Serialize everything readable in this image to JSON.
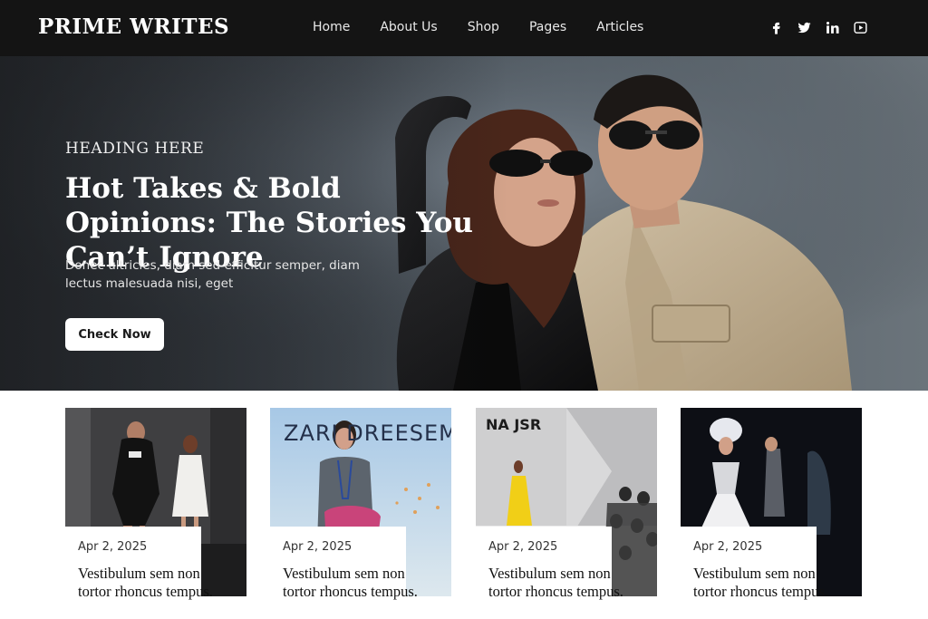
{
  "brand": "PRIME WRITES",
  "nav": [
    "Home",
    "About Us",
    "Shop",
    "Pages",
    "Articles"
  ],
  "social": [
    "facebook-icon",
    "twitter-icon",
    "linkedin-icon",
    "youtube-icon"
  ],
  "hero": {
    "eyebrow": "HEADING HERE",
    "headline": "Hot Takes & Bold Opinions: The Stories You Can’t Ignore",
    "lede": "Donec ultricles, diam sed efficitur semper, diam lectus malesuada nisi, eget",
    "cta": "Check Now"
  },
  "cards": [
    {
      "date": "Apr 2, 2025",
      "title": "Vestibulum sem non tortor rhoncus tempus."
    },
    {
      "date": "Apr 2, 2025",
      "title": "Vestibulum sem non tortor rhoncus tempus.",
      "thumb_text": "ZARI DREESEM"
    },
    {
      "date": "Apr 2, 2025",
      "title": "Vestibulum sem non tortor rhoncus tempus.",
      "thumb_text": "NA JSR"
    },
    {
      "date": "Apr 2, 2025",
      "title": "Vestibulum sem non tortor rhoncus tempus."
    }
  ]
}
